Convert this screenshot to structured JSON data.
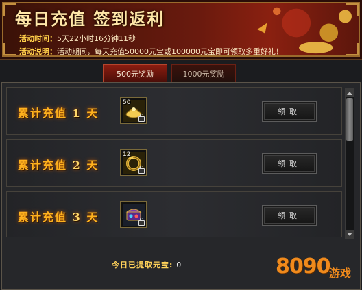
{
  "banner": {
    "title": "每日充值 签到返利",
    "time_label": "活动时间：",
    "time_value": "5天22小时16分钟11秒",
    "desc_label": "活动说明：",
    "desc_value": "活动期间，每天充值50000元宝或100000元宝即可领取多重好礼！"
  },
  "tabs": [
    {
      "label": "500元奖励",
      "active": true
    },
    {
      "label": "1000元奖励",
      "active": false
    }
  ],
  "rows": [
    {
      "title_pre": "累计充值",
      "day": "1",
      "title_post": "天",
      "reward_count": "50",
      "reward_icon": "gold-ingot-icon",
      "button": "领取"
    },
    {
      "title_pre": "累计充值",
      "day": "2",
      "title_post": "天",
      "reward_count": "12",
      "reward_icon": "gold-ring-icon",
      "button": "领取"
    },
    {
      "title_pre": "累计充值",
      "day": "3",
      "title_post": "天",
      "reward_count": "",
      "reward_icon": "gem-chest-icon",
      "button": "领取"
    }
  ],
  "footer": {
    "label": "今日已提取元宝:",
    "value": "0"
  },
  "watermark": {
    "number": "8090",
    "text": "游戏"
  },
  "colors": {
    "accent": "#ffb21e",
    "tab_active": "#8c1d10",
    "watermark": "#f08a1c"
  }
}
